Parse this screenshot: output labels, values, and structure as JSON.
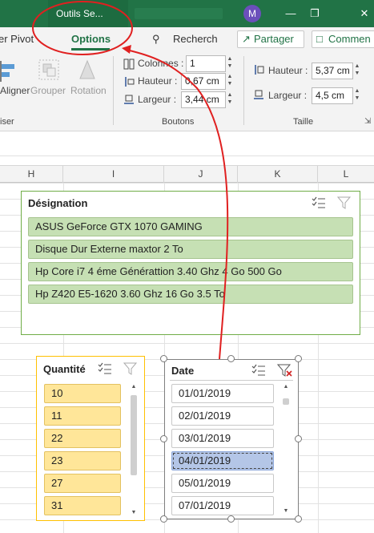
{
  "titlebar": {
    "tab_label": "Outils Se...",
    "avatar_initial": "M"
  },
  "tabs": {
    "partial_tab": "er Pivot",
    "active_tab": "Options",
    "search_label": "Recherch",
    "share_label": "Partager",
    "comment_label": "Commen"
  },
  "ribbon": {
    "align_label": "Aligner",
    "group_label": "Grouper",
    "rotation_label": "Rotation",
    "left_group_title": "iser",
    "columns_label": "Colonnes :",
    "columns_value": "1",
    "height_label": "Hauteur :",
    "height_value": "0,67 cm",
    "width_label": "Largeur :",
    "width_value": "3,44 cm",
    "buttons_group_title": "Boutons",
    "size_height_label": "Hauteur :",
    "size_height_value": "5,37 cm",
    "size_width_label": "Largeur :",
    "size_width_value": "4,5 cm",
    "size_group_title": "Taille"
  },
  "columns": [
    "H",
    "I",
    "J",
    "K",
    "L"
  ],
  "slicer_designation": {
    "title": "Désignation",
    "items": [
      "ASUS GeForce GTX 1070 GAMING",
      "Disque Dur Externe maxtor 2 To",
      "Hp Core i7 4 éme Générattion 3.40 Ghz 4 Go 500 Go",
      "Hp Z420 E5-1620 3.60 Ghz 16 Go 3.5 To"
    ]
  },
  "slicer_quantite": {
    "title": "Quantité",
    "items": [
      "10",
      "11",
      "22",
      "23",
      "27",
      "31"
    ]
  },
  "slicer_date": {
    "title": "Date",
    "items": [
      "01/01/2019",
      "02/01/2019",
      "03/01/2019",
      "04/01/2019",
      "05/01/2019",
      "07/01/2019"
    ],
    "selected_index": 3
  },
  "colors": {
    "excel_green": "#217346",
    "annotation_red": "#e02020",
    "designation_item": "#c6e0b4",
    "quantite_item": "#ffe699",
    "date_selected": "#b4c6e7"
  }
}
